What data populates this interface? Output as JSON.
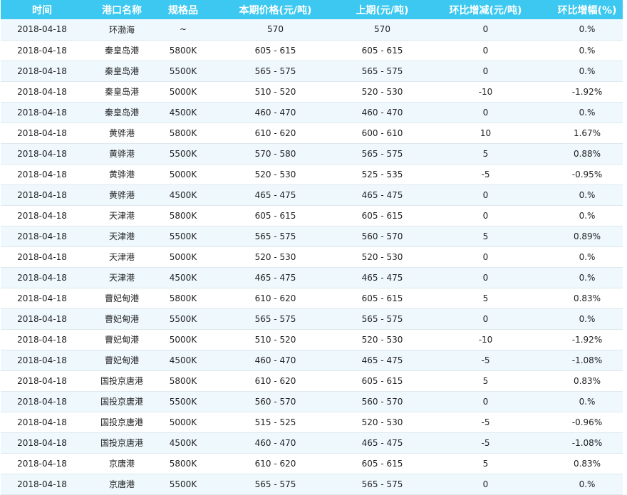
{
  "table": {
    "headers": [
      "时间",
      "港口名称",
      "规格品",
      "本期价格(元/吨)",
      "上期(元/吨)",
      "环比增减(元/吨)",
      "环比增幅(%)"
    ],
    "rows": [
      [
        "2018-04-18",
        "环渤海",
        "~",
        "570",
        "570",
        "0",
        "0.%"
      ],
      [
        "2018-04-18",
        "秦皇岛港",
        "5800K",
        "605 - 615",
        "605 - 615",
        "0",
        "0.%"
      ],
      [
        "2018-04-18",
        "秦皇岛港",
        "5500K",
        "565 - 575",
        "565 - 575",
        "0",
        "0.%"
      ],
      [
        "2018-04-18",
        "秦皇岛港",
        "5000K",
        "510 - 520",
        "520 - 530",
        "-10",
        "-1.92%"
      ],
      [
        "2018-04-18",
        "秦皇岛港",
        "4500K",
        "460 - 470",
        "460 - 470",
        "0",
        "0.%"
      ],
      [
        "2018-04-18",
        "黄骅港",
        "5800K",
        "610 - 620",
        "600 - 610",
        "10",
        "1.67%"
      ],
      [
        "2018-04-18",
        "黄骅港",
        "5500K",
        "570 - 580",
        "565 - 575",
        "5",
        "0.88%"
      ],
      [
        "2018-04-18",
        "黄骅港",
        "5000K",
        "520 - 530",
        "525 - 535",
        "-5",
        "-0.95%"
      ],
      [
        "2018-04-18",
        "黄骅港",
        "4500K",
        "465 - 475",
        "465 - 475",
        "0",
        "0.%"
      ],
      [
        "2018-04-18",
        "天津港",
        "5800K",
        "605 - 615",
        "605 - 615",
        "0",
        "0.%"
      ],
      [
        "2018-04-18",
        "天津港",
        "5500K",
        "565 - 575",
        "560 - 570",
        "5",
        "0.89%"
      ],
      [
        "2018-04-18",
        "天津港",
        "5000K",
        "520 - 530",
        "520 - 530",
        "0",
        "0.%"
      ],
      [
        "2018-04-18",
        "天津港",
        "4500K",
        "465 - 475",
        "465 - 475",
        "0",
        "0.%"
      ],
      [
        "2018-04-18",
        "曹妃甸港",
        "5800K",
        "610 - 620",
        "605 - 615",
        "5",
        "0.83%"
      ],
      [
        "2018-04-18",
        "曹妃甸港",
        "5500K",
        "565 - 575",
        "565 - 575",
        "0",
        "0.%"
      ],
      [
        "2018-04-18",
        "曹妃甸港",
        "5000K",
        "510 - 520",
        "520 - 530",
        "-10",
        "-1.92%"
      ],
      [
        "2018-04-18",
        "曹妃甸港",
        "4500K",
        "460 - 470",
        "465 - 475",
        "-5",
        "-1.08%"
      ],
      [
        "2018-04-18",
        "国投京唐港",
        "5800K",
        "610 - 620",
        "605 - 615",
        "5",
        "0.83%"
      ],
      [
        "2018-04-18",
        "国投京唐港",
        "5500K",
        "560 - 570",
        "560 - 570",
        "0",
        "0.%"
      ],
      [
        "2018-04-18",
        "国投京唐港",
        "5000K",
        "515 - 525",
        "520 - 530",
        "-5",
        "-0.96%"
      ],
      [
        "2018-04-18",
        "国投京唐港",
        "4500K",
        "460 - 470",
        "465 - 475",
        "-5",
        "-1.08%"
      ],
      [
        "2018-04-18",
        "京唐港",
        "5800K",
        "610 - 620",
        "605 - 615",
        "5",
        "0.83%"
      ],
      [
        "2018-04-18",
        "京唐港",
        "5500K",
        "565 - 575",
        "565 - 575",
        "0",
        "0.%"
      ]
    ]
  },
  "colors": {
    "header_bg": "#3cc8f0",
    "header_text": "#ffffff",
    "row_alt_bg": "#eef8fd",
    "row_bg": "#ffffff"
  }
}
